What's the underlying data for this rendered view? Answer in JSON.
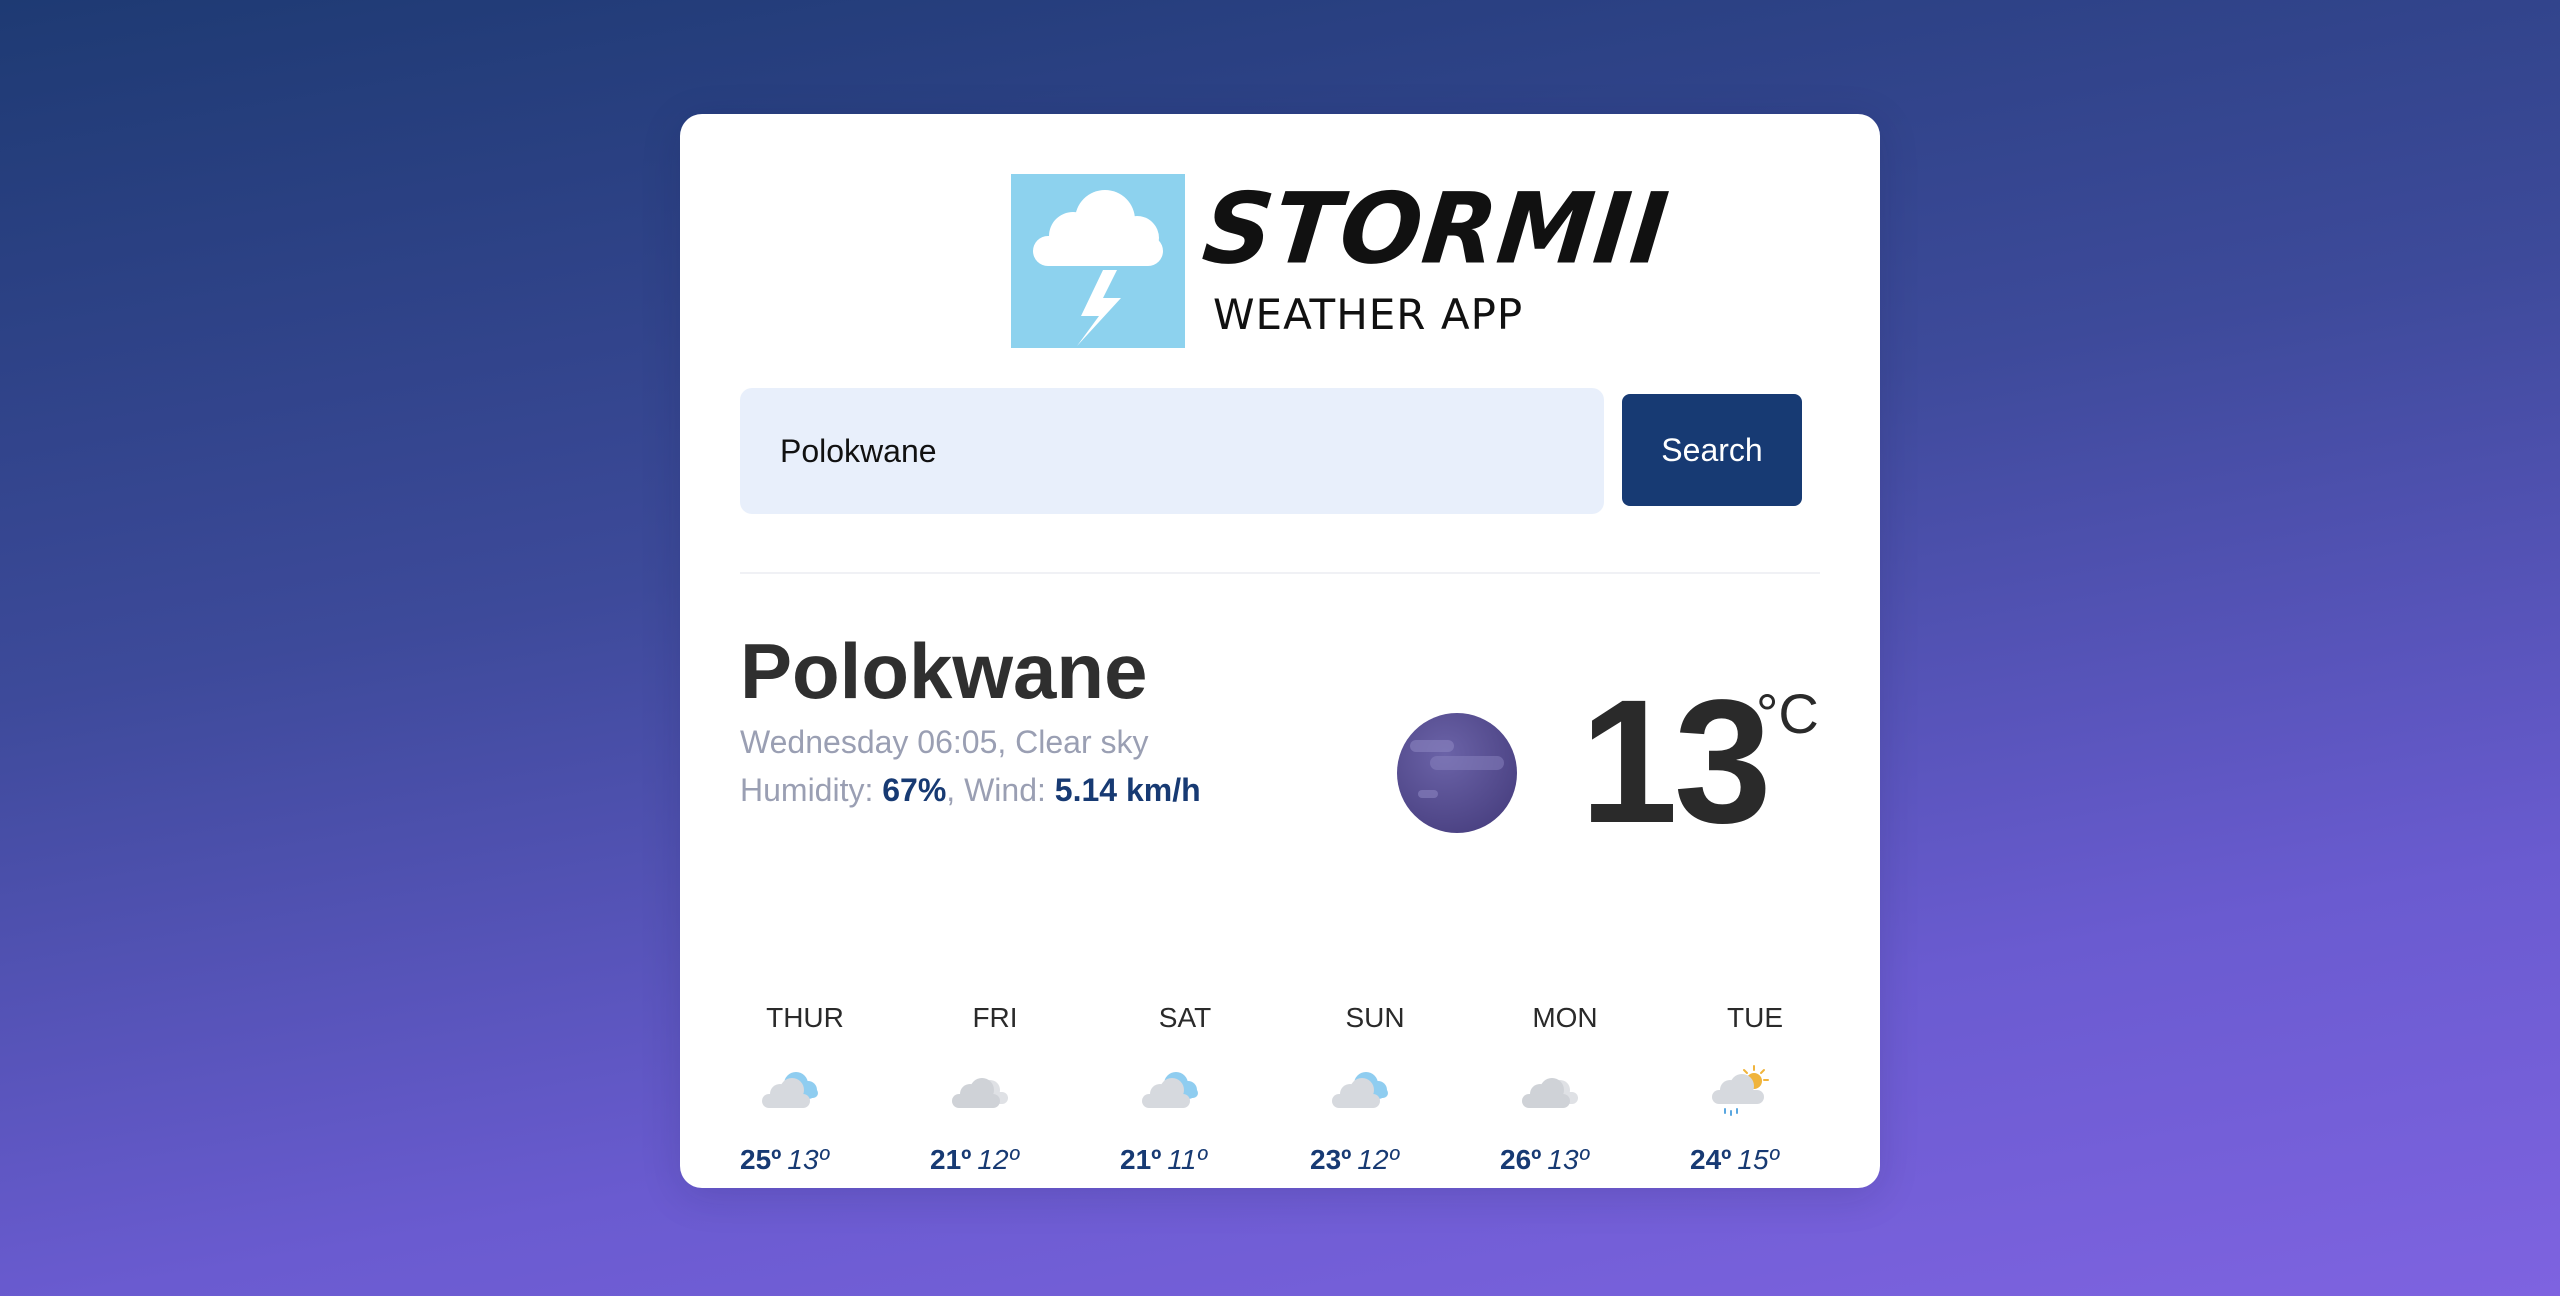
{
  "logo": {
    "title": "STORMII",
    "subtitle": "WEATHER APP",
    "icon": "storm-cloud-icon",
    "box_color": "#8dd2ee"
  },
  "search": {
    "value": "Polokwane",
    "button_label": "Search"
  },
  "current": {
    "city": "Polokwane",
    "date_line": "Wednesday 06:05, Clear sky",
    "humidity_label": "Humidity: ",
    "humidity": "67%",
    "wind_label": ", Wind: ",
    "wind": "5.14 km/h",
    "icon": "night-moon-icon",
    "temperature": "13",
    "unit": "°C"
  },
  "forecast": [
    {
      "day": "THUR",
      "icon": "cloudy-icon",
      "max": "25º",
      "min": "13º"
    },
    {
      "day": "FRI",
      "icon": "overcast-icon",
      "max": "21º",
      "min": "12º"
    },
    {
      "day": "SAT",
      "icon": "cloudy-icon",
      "max": "21º",
      "min": "11º"
    },
    {
      "day": "SUN",
      "icon": "cloudy-icon",
      "max": "23º",
      "min": "12º"
    },
    {
      "day": "MON",
      "icon": "overcast-icon",
      "max": "26º",
      "min": "13º"
    },
    {
      "day": "TUE",
      "icon": "sun-rain-icon",
      "max": "24º",
      "min": "15º"
    }
  ],
  "colors": {
    "accent": "#173a73",
    "input_bg": "#e8effb",
    "muted_text": "#9a9fb3"
  }
}
